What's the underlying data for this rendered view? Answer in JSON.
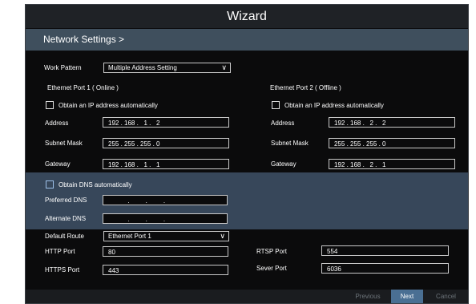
{
  "title": "Wizard",
  "breadcrumb": "Network Settings  >",
  "work_pattern": {
    "label": "Work Pattern",
    "value": "Multiple Address Setting"
  },
  "port1": {
    "header": "Ethernet Port 1 ( Online )",
    "auto_ip_label": "Obtain an IP address automatically",
    "address_label": "Address",
    "address": "192 . 168 .   1 .   2",
    "subnet_label": "Subnet Mask",
    "subnet": "255 . 255 . 255 . 0",
    "gateway_label": "Gateway",
    "gateway": "192 . 168 .   1 .   1"
  },
  "port2": {
    "header": "Ethernet Port 2 ( Offline )",
    "auto_ip_label": "Obtain an IP address automatically",
    "address_label": "Address",
    "address": "192 . 168 .   2 .   2",
    "subnet_label": "Subnet Mask",
    "subnet": "255 . 255 . 255 . 0",
    "gateway_label": "Gateway",
    "gateway": "192 . 168 .   2 .   1"
  },
  "dns": {
    "auto_label": "Obtain DNS automatically",
    "preferred_label": "Preferred  DNS",
    "preferred": "           .         .         .",
    "alternate_label": "Alternate  DNS",
    "alternate": "           .         .         ."
  },
  "default_route": {
    "label": "Default Route",
    "value": "Ethernet Port 1"
  },
  "http": {
    "label": "HTTP Port",
    "value": "80"
  },
  "https": {
    "label": "HTTPS Port",
    "value": "443"
  },
  "rtsp": {
    "label": "RTSP Port",
    "value": "554"
  },
  "server": {
    "label": "Sever Port",
    "value": "6036"
  },
  "buttons": {
    "previous": "Previous",
    "next": "Next",
    "cancel": "Cancel"
  },
  "colors": {
    "background": "#0b0b0c",
    "title_bar": "#1f2226",
    "breadcrumb_bar": "#3f4f5d",
    "dns_band": "#37475a",
    "next_button": "#4a6f93"
  }
}
